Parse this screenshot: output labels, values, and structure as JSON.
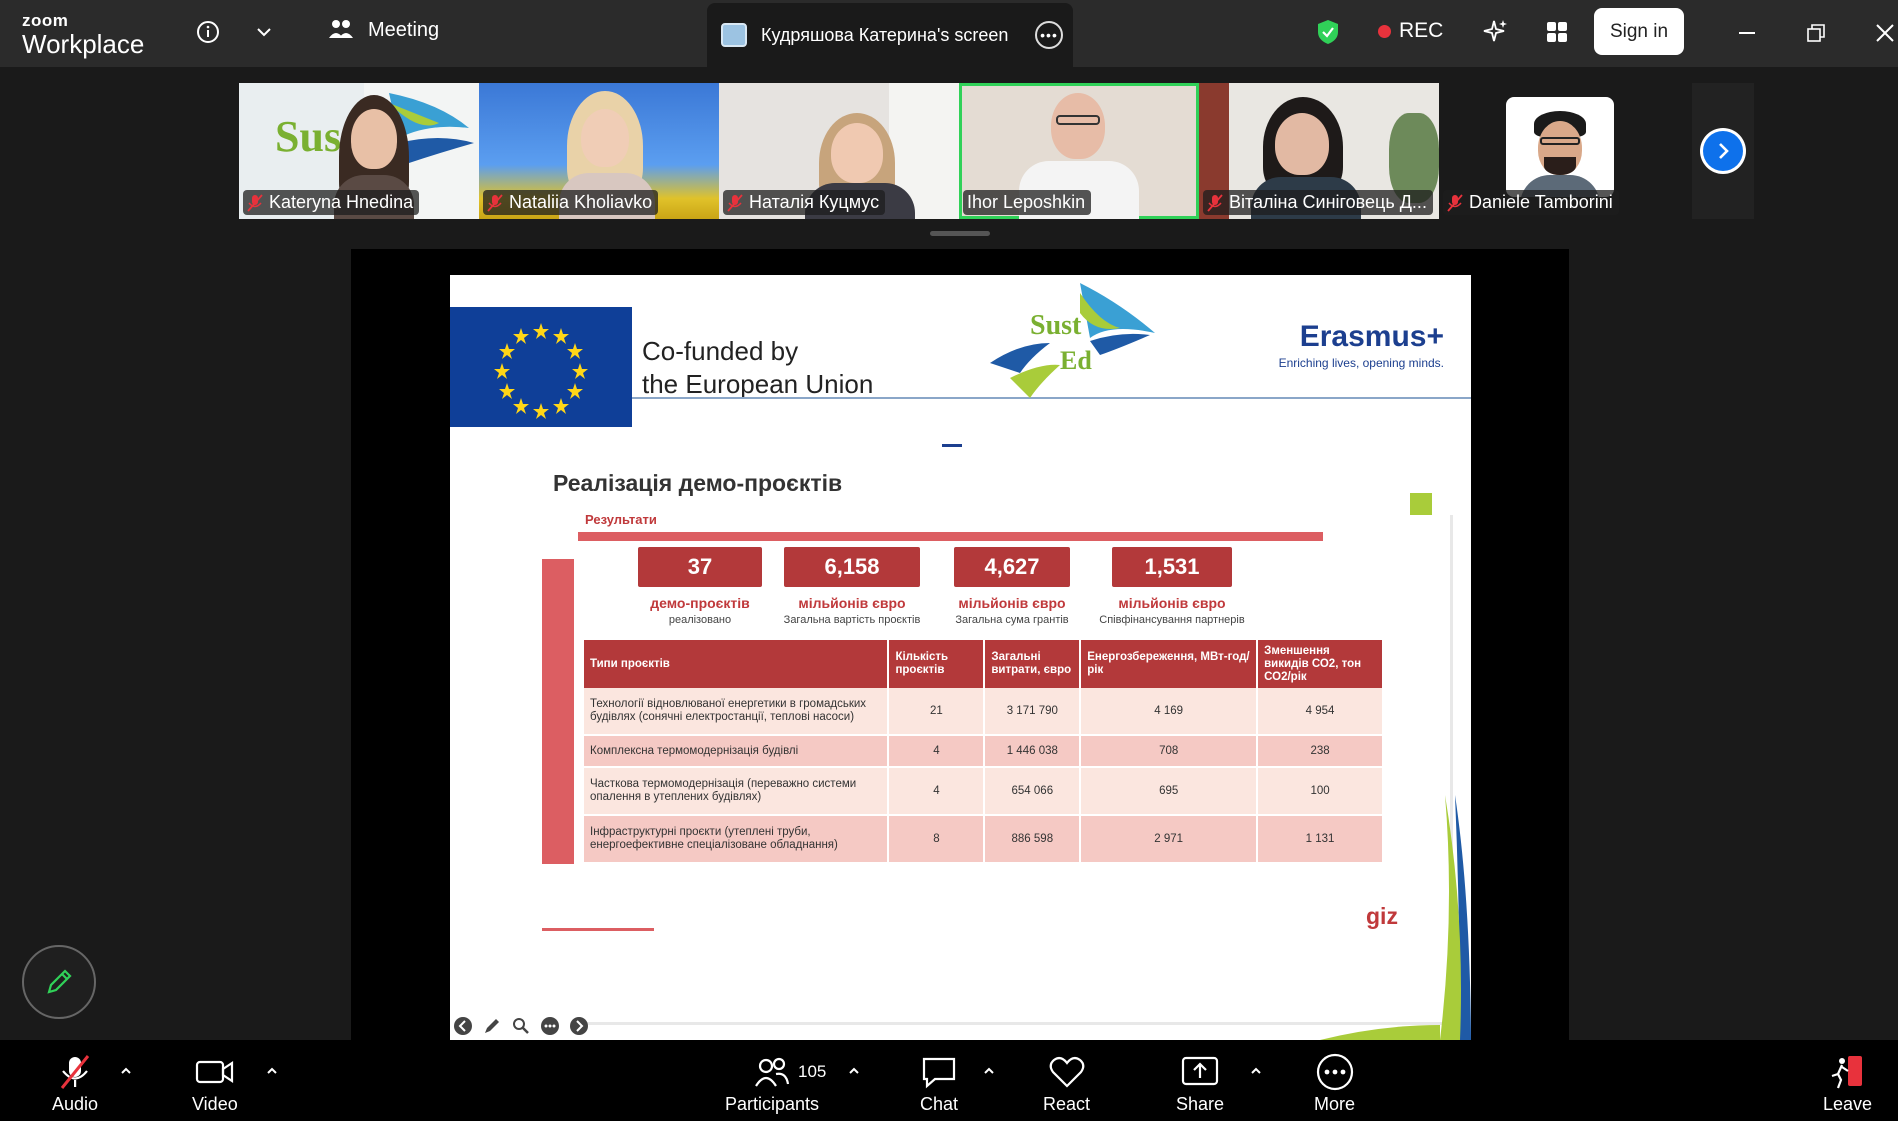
{
  "titlebar": {
    "logo_line1": "zoom",
    "logo_line2": "Workplace",
    "meeting_label": "Meeting",
    "screen_tab_label": "Кудряшова Катерина's screen",
    "rec_label": "REC",
    "signin_label": "Sign in"
  },
  "participants": [
    {
      "name": "Kateryna Hnedina"
    },
    {
      "name": "Nataliia Kholiavko"
    },
    {
      "name": "Наталія Куцмус"
    },
    {
      "name": "Ihor Leposhkin"
    },
    {
      "name": "Віталіна Синіговець Д..."
    },
    {
      "name": "Daniele Tamborini"
    }
  ],
  "slide": {
    "cofunded_line1": "Co-funded by",
    "cofunded_line2": "the European Union",
    "sust_logo_line1": "Sust",
    "sust_logo_line2": "Ed",
    "tile_logo_text": "Sus",
    "erasmus_title": "Erasmus+",
    "erasmus_tagline": "Enriching lives, opening minds.",
    "title": "Реалізація демо-проєктів",
    "results_label": "Результати",
    "stats": [
      {
        "value": "37",
        "label": "демо-проєктів",
        "sublabel": "реалізовано"
      },
      {
        "value": "6,158",
        "label": "мільйонів євро",
        "sublabel": "Загальна вартість проєктів"
      },
      {
        "value": "4,627",
        "label": "мільйонів євро",
        "sublabel": "Загальна сума грантів"
      },
      {
        "value": "1,531",
        "label": "мільйонів євро",
        "sublabel": "Співфінансування партнерів"
      }
    ],
    "table": {
      "headers": [
        "Типи проєктів",
        "Кількість проєктів",
        "Загальні витрати, євро",
        "Енергозбереження, МВт-год/рік",
        "Зменшення викидів СО2, тон СО2/рік"
      ],
      "rows": [
        [
          "Технології відновлюваної енергетики в громадських будівлях (сонячні електростанції, теплові насоси)",
          "21",
          "3 171 790",
          "4 169",
          "4 954"
        ],
        [
          "Комплексна термомодернізація будівлі",
          "4",
          "1 446 038",
          "708",
          "238"
        ],
        [
          "Часткова термомодернізація (переважно системи опалення в утеплених будівлях)",
          "4",
          "654 066",
          "695",
          "100"
        ],
        [
          "Інфраструктурні проєкти (утеплені труби, енергоефективне спеціалізоване обладнання)",
          "8",
          "886 598",
          "2 971",
          "1 131"
        ]
      ]
    },
    "giz_logo": "giz"
  },
  "toolbar": {
    "audio_label": "Audio",
    "video_label": "Video",
    "participants_label": "Participants",
    "participants_count": "105",
    "chat_label": "Chat",
    "react_label": "React",
    "share_label": "Share",
    "more_label": "More",
    "leave_label": "Leave"
  },
  "colors": {
    "titlebar_bg": "#2b2b2b",
    "toolbar_bg": "#000000",
    "active_speaker": "#30d158",
    "rec_red": "#e8323c",
    "slide_red": "#b3393a",
    "zoom_blue": "#0e71eb"
  }
}
